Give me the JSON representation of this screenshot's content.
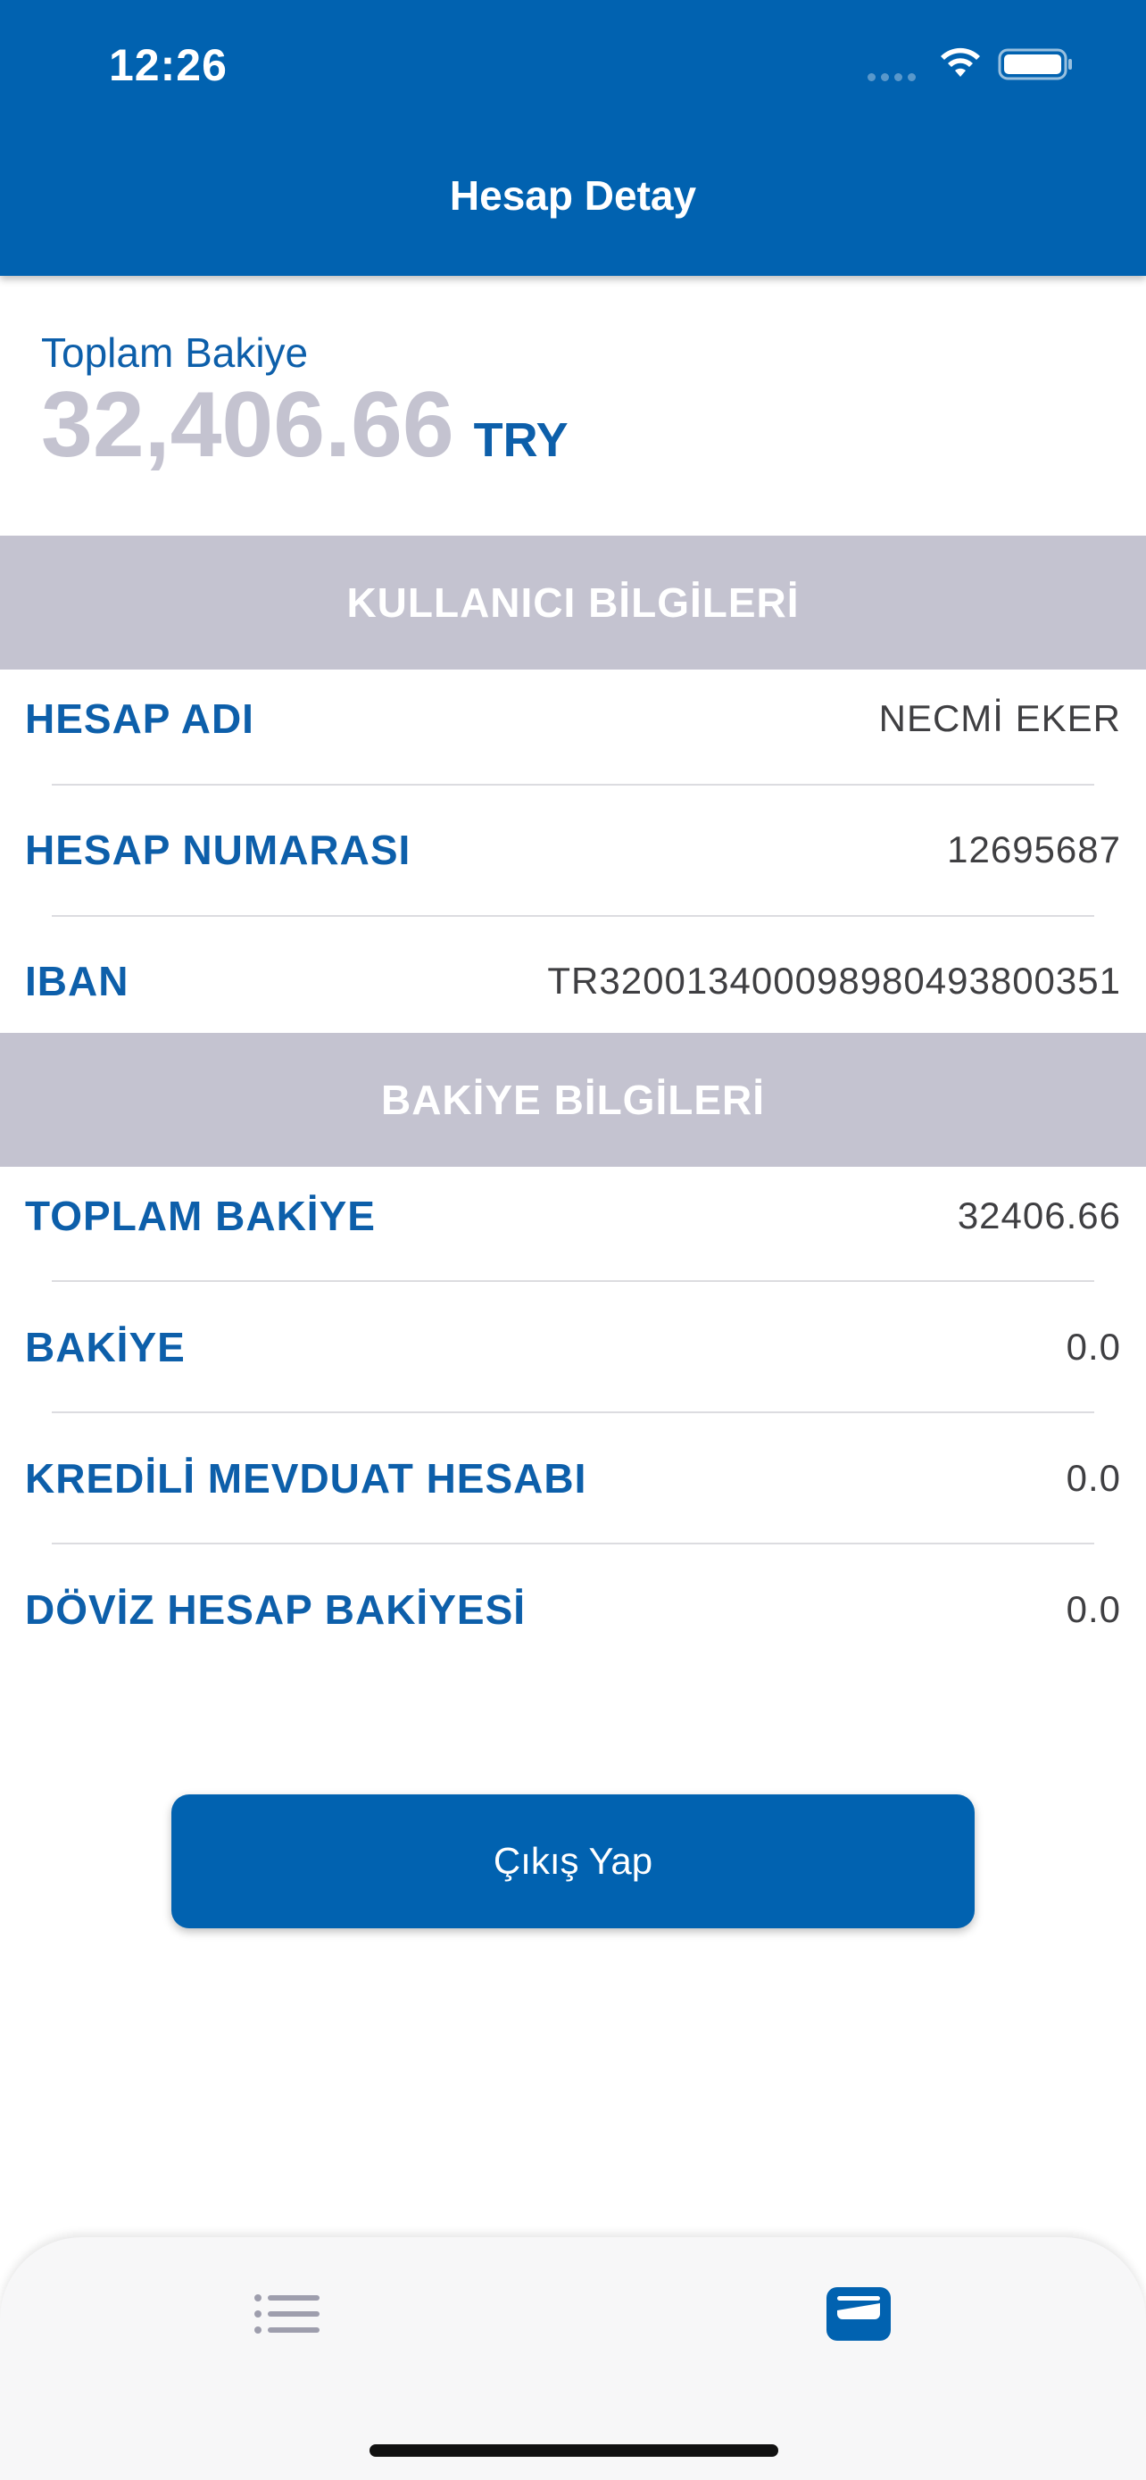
{
  "status_bar": {
    "time": "12:26"
  },
  "header": {
    "title": "Hesap Detay"
  },
  "balance": {
    "label": "Toplam Bakiye",
    "amount": "32,406.66",
    "currency": "TRY"
  },
  "user_section": {
    "title": "KULLANICI BİLGİLERİ",
    "rows": [
      {
        "label": "HESAP ADI",
        "value": "NECMİ EKER"
      },
      {
        "label": "HESAP NUMARASI",
        "value": "12695687"
      },
      {
        "label": "IBAN",
        "value": "TR320013400098980493800351"
      }
    ]
  },
  "balance_section": {
    "title": "BAKİYE BİLGİLERİ",
    "rows": [
      {
        "label": "TOPLAM BAKİYE",
        "value": "32406.66"
      },
      {
        "label": "BAKİYE",
        "value": "0.0"
      },
      {
        "label": "KREDİLİ MEVDUAT HESABI",
        "value": "0.0"
      },
      {
        "label": "DÖVİZ HESAP BAKİYESİ",
        "value": "0.0"
      }
    ]
  },
  "logout_button": {
    "label": "Çıkış Yap"
  },
  "tab_bar": {
    "items": [
      {
        "icon": "list-icon",
        "active": false
      },
      {
        "icon": "wallet-icon",
        "active": true
      }
    ]
  },
  "colors": {
    "primary": "#0162b0",
    "label_blue": "#0d5faa",
    "section_gray": "#c4c3d0",
    "value_text": "#3f3f42"
  }
}
